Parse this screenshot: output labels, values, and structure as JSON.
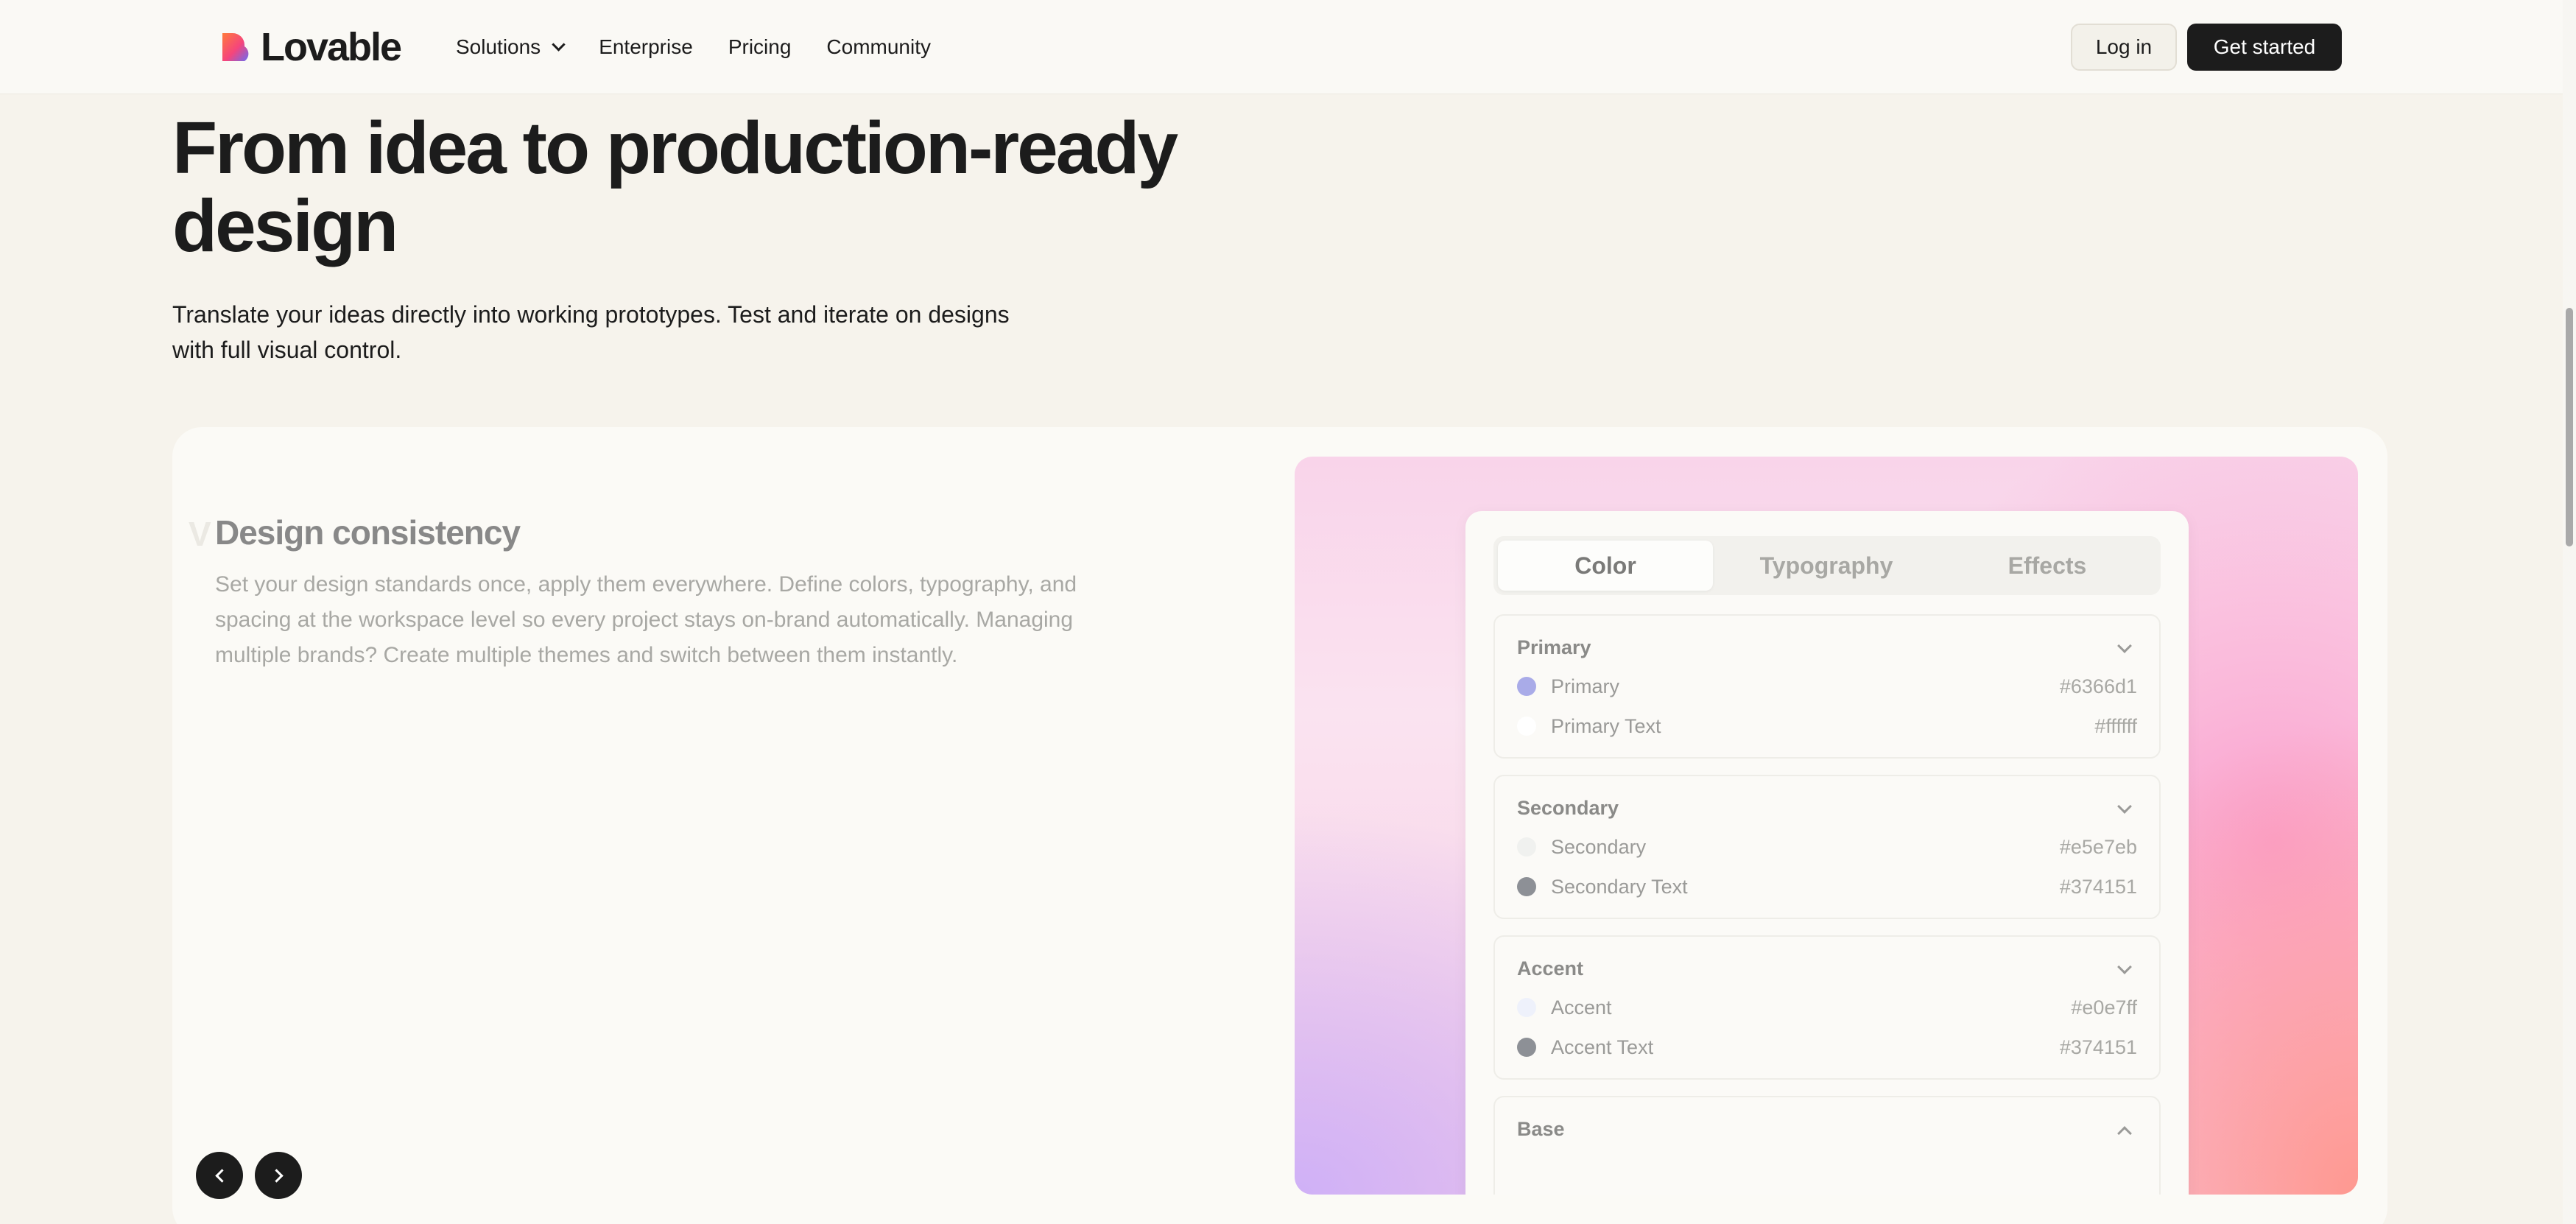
{
  "nav": {
    "brand": "Lovable",
    "links": [
      "Solutions",
      "Enterprise",
      "Pricing",
      "Community"
    ],
    "login": "Log in",
    "get_started": "Get started"
  },
  "hero": {
    "title": "From idea to production-ready design",
    "subtitle": "Translate your ideas directly into working prototypes. Test and iterate on designs with full visual control."
  },
  "feature": {
    "title": "Design consistency",
    "description": "Set your design standards once, apply them everywhere. Define colors, typography, and spacing at the workspace level so every project stays on-brand automatically. Managing multiple brands? Create multiple themes and switch between them instantly.",
    "ghost_letter": "V"
  },
  "panel": {
    "tabs": [
      "Color",
      "Typography",
      "Effects"
    ],
    "active_tab": "Color",
    "sections": [
      {
        "title": "Primary",
        "rows": [
          {
            "label": "Primary",
            "value": "#6366d1",
            "swatch": "#a9abe8"
          },
          {
            "label": "Primary Text",
            "value": "#ffffff",
            "swatch": "#ffffff"
          }
        ]
      },
      {
        "title": "Secondary",
        "rows": [
          {
            "label": "Secondary",
            "value": "#e5e7eb",
            "swatch": "#f0f1ef"
          },
          {
            "label": "Secondary Text",
            "value": "#374151",
            "swatch": "#8d9096"
          }
        ]
      },
      {
        "title": "Accent",
        "rows": [
          {
            "label": "Accent",
            "value": "#e0e7ff",
            "swatch": "#eef1fb"
          },
          {
            "label": "Accent Text",
            "value": "#374151",
            "swatch": "#8d9096"
          }
        ]
      },
      {
        "title": "Base",
        "rows": []
      }
    ]
  },
  "colors": {
    "ink": "#1c1c1c",
    "page_bg": "#f6f3ec",
    "card_bg": "#fbfaf6"
  },
  "icons": [
    "lovable-logo-icon",
    "chevron-down-icon",
    "chevron-up-icon",
    "arrow-left-icon",
    "arrow-right-icon"
  ]
}
